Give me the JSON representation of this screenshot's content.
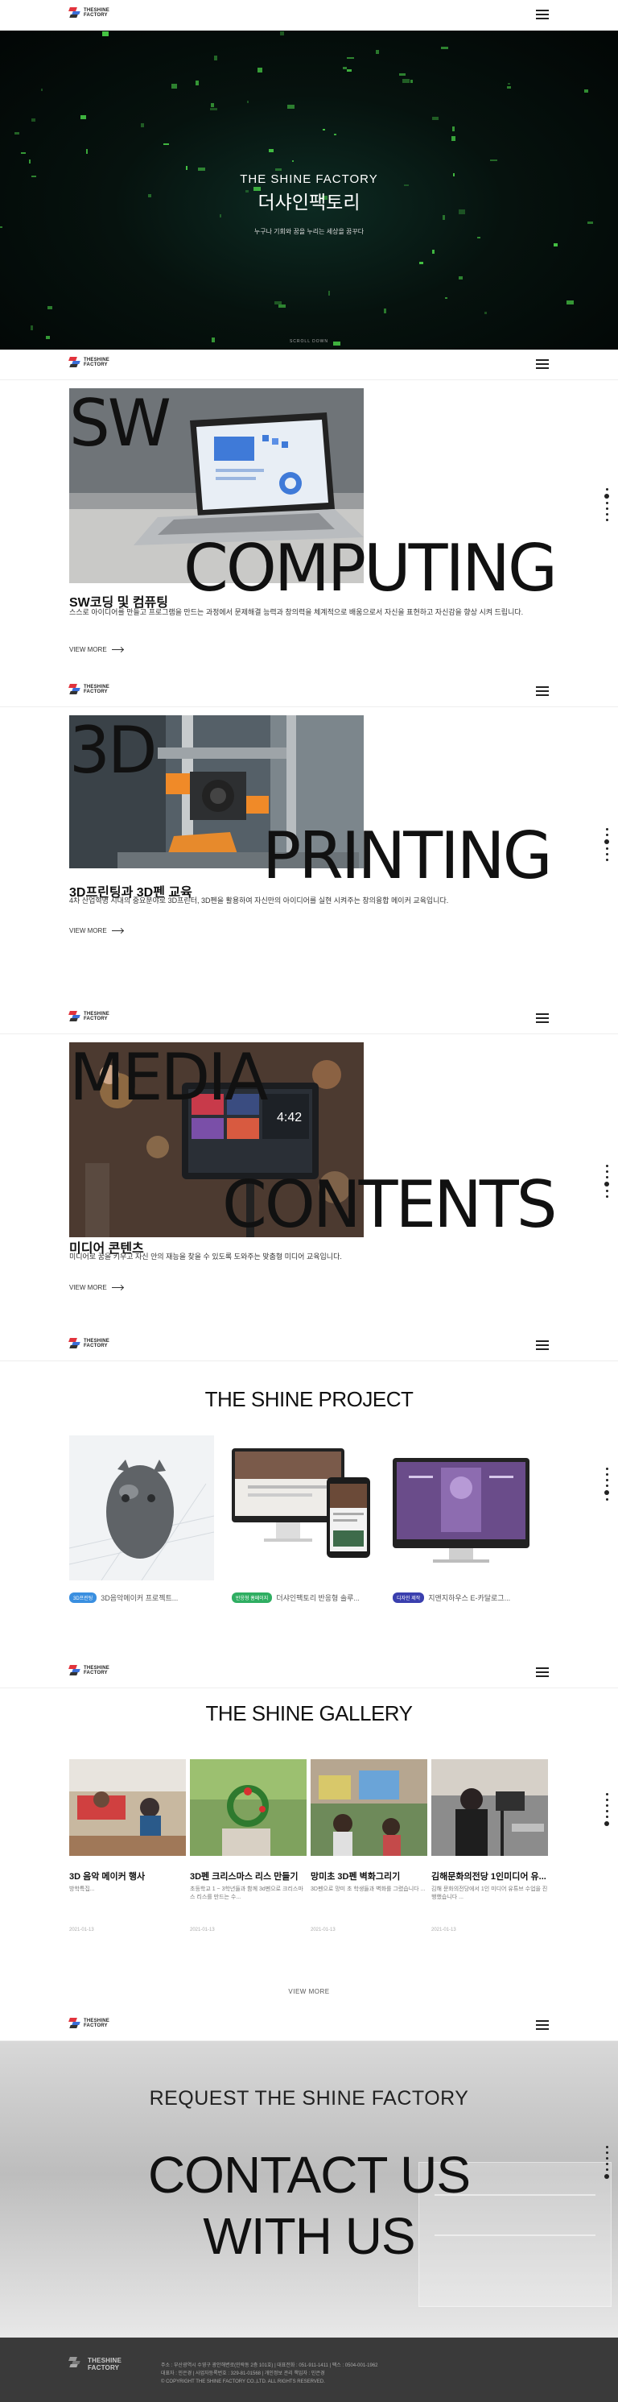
{
  "brand": {
    "line1": "THESHINE",
    "line2": "FACTORY"
  },
  "hero": {
    "title_en": "THE SHINE FACTORY",
    "title_ko": "더샤인팩토리",
    "subtitle": "누구나 기회와 꿈을 누리는 세상을 꿈꾸다",
    "scroll": "SCROLL DOWN"
  },
  "courses": [
    {
      "big1": "SW",
      "big2": "COMPUTING",
      "title": "SW코딩 및 컴퓨팅",
      "desc": "스스로 아이디어를 만들고 프로그램을 만드는 과정에서 문제해결 능력과 창의력을 체계적으로 배움으로서 자신을 표현하고 자신감을 향상 시켜 드립니다.",
      "more": "VIEW MORE"
    },
    {
      "big1": "3D",
      "big2": "PRINTING",
      "title": "3D프린팅과 3D펜 교육",
      "desc": "4차 산업혁명 시대의 중요분야로 3D프린터, 3D펜을 활용하여 자신만의 아이디어를 실현 시켜주는 창의융합 메이커 교육입니다.",
      "more": "VIEW MORE"
    },
    {
      "big1": "MEDIA",
      "big2": "CONTENTS",
      "title": "미디어 콘텐츠",
      "desc": "미디어로 꿈을 키우고 자신 안의 재능을 찾을 수 있도록 도와주는 맞춤형 미디어 교육입니다.",
      "more": "VIEW MORE"
    }
  ],
  "project": {
    "title": "THE SHINE PROJECT",
    "items": [
      {
        "badge": "3D프린팅",
        "badge_color": "#3a8fe0",
        "label": "3D음악메이커 프로젝트..."
      },
      {
        "badge": "반응형 홈페이지",
        "badge_color": "#2fae62",
        "label": "더샤인팩토리 반응형 솔루..."
      },
      {
        "badge": "디자인 제작",
        "badge_color": "#3a3fae",
        "label": "지앤지하우스 E-카달로그..."
      }
    ]
  },
  "gallery": {
    "title": "THE SHINE GALLERY",
    "more": "VIEW MORE",
    "items": [
      {
        "title": "3D 음악 메이커 행사",
        "sub": "방학특집...",
        "date": "2021-01-13"
      },
      {
        "title": "3D펜 크리스마스 리스 만들기",
        "sub": "초등학교 1 ~ 3학년들과 함께 3d펜으로 크리스마스 리스를 만드는 수...",
        "date": "2021-01-13"
      },
      {
        "title": "망미초 3D펜 벽화그리기",
        "sub": "3D펜으로 망미 초 학생들과 벽화를 그렸습니다 ...",
        "date": "2021-01-13"
      },
      {
        "title": "김해문화의전당 1인미디어 유...",
        "sub": "김해 문화의전당에서 1인 미디어 유튜브 수업을 진행했습니다 ...",
        "date": "2021-01-13"
      }
    ]
  },
  "contact": {
    "request": "REQUEST THE SHINE FACTORY",
    "line1": "CONTACT US",
    "line2": "WITH US"
  },
  "footer": {
    "info1": "주소 : 부산광역시 수영구 광안해변로(민락동 2층 101호)  |  대표전화 : 051-911-1411  |  팩스 : 0504-001-1962",
    "info2": "대표자 : 민은경  |  사업자등록번호 : 329-81-01568  |  개인정보 관리 책임자 : 민은경",
    "copy": "© COPYRIGHT THE SHINE FACTORY CO.,LTD. ALL RIGHTS RESERVED."
  }
}
